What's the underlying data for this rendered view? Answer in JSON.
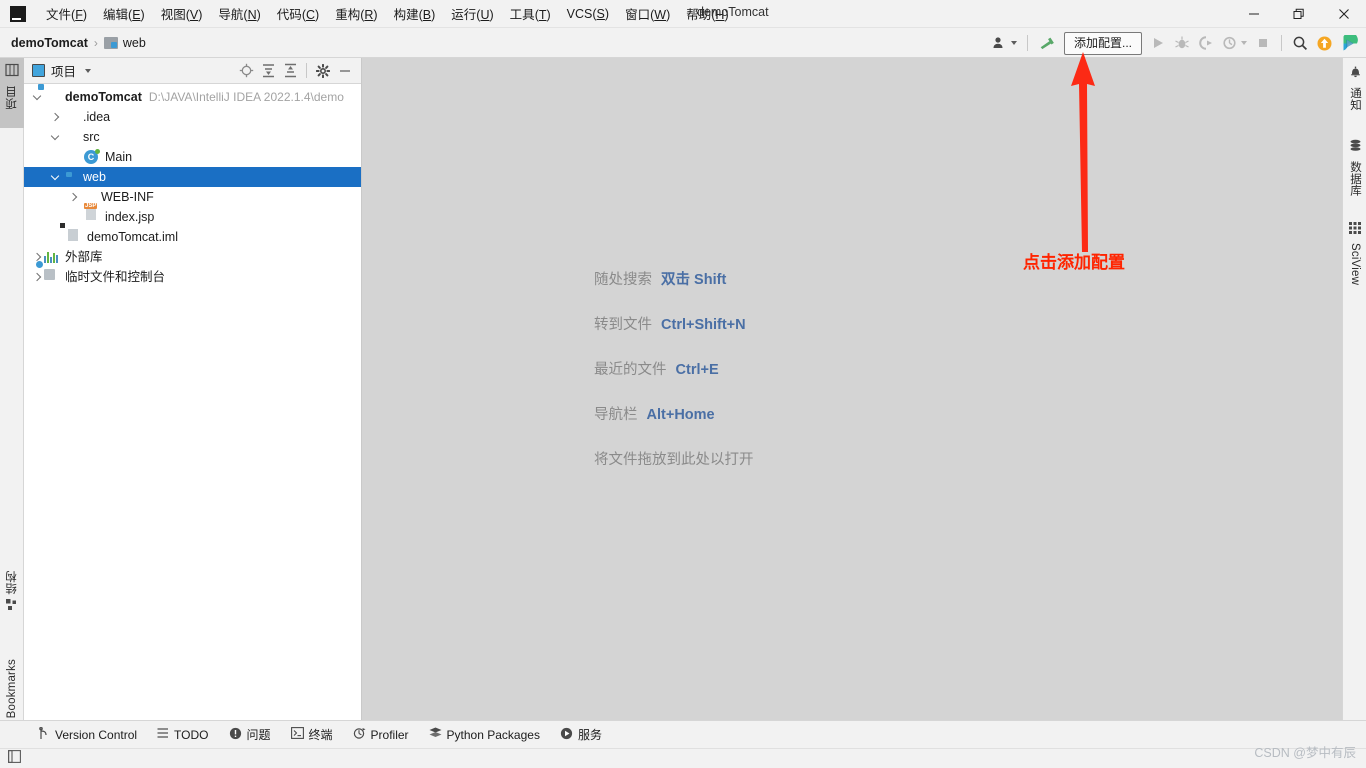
{
  "window": {
    "title": "demoTomcat",
    "controls": {
      "minimize": "—",
      "maximize": "❐",
      "close": "✕"
    }
  },
  "menubar": {
    "logo": "IJ",
    "items": [
      {
        "label": "文件",
        "mnemonic": "F"
      },
      {
        "label": "编辑",
        "mnemonic": "E"
      },
      {
        "label": "视图",
        "mnemonic": "V"
      },
      {
        "label": "导航",
        "mnemonic": "N"
      },
      {
        "label": "代码",
        "mnemonic": "C"
      },
      {
        "label": "重构",
        "mnemonic": "R"
      },
      {
        "label": "构建",
        "mnemonic": "B"
      },
      {
        "label": "运行",
        "mnemonic": "U"
      },
      {
        "label": "工具",
        "mnemonic": "T"
      },
      {
        "label": "VCS",
        "mnemonic": "S"
      },
      {
        "label": "窗口",
        "mnemonic": "W"
      },
      {
        "label": "帮助",
        "mnemonic": "H"
      }
    ]
  },
  "navbar": {
    "breadcrumb": {
      "root": "demoTomcat",
      "separator": "›",
      "leaf": "web"
    },
    "toolbar": {
      "add_config_label": "添加配置...",
      "run_tooltip": "运行",
      "debug_tooltip": "调试",
      "coverage_tooltip": "运行覆盖率",
      "profile_tooltip": "性能分析",
      "stop_tooltip": "停止",
      "search_tooltip": "搜索",
      "update_tooltip": "更新项目",
      "trainer_tooltip": "IDE 功能训练器"
    }
  },
  "left_stripe": {
    "top": [
      {
        "label": "项目",
        "icon": "project-icon",
        "active": true
      }
    ],
    "bottom": [
      {
        "label": "结构",
        "icon": "structure-icon"
      },
      {
        "label": "Bookmarks",
        "icon": "bookmark-icon"
      }
    ]
  },
  "right_stripe": {
    "items": [
      {
        "label": "通知",
        "icon": "bell-icon"
      },
      {
        "label": "数据库",
        "icon": "database-icon"
      },
      {
        "label": "SciView",
        "icon": "grid-icon"
      }
    ]
  },
  "project_panel": {
    "title": "项目",
    "actions": [
      "locate-icon",
      "expand-all-icon",
      "collapse-all-icon",
      "settings-gear-icon",
      "hide-icon"
    ],
    "tree": [
      {
        "label": "demoTomcat",
        "path": "D:\\JAVA\\IntelliJ IDEA 2022.1.4\\demo",
        "icon": "module-icon",
        "depth": 0,
        "state": "expanded",
        "bold": true
      },
      {
        "label": ".idea",
        "icon": "folder-icon",
        "depth": 1,
        "state": "collapsed"
      },
      {
        "label": "src",
        "icon": "source-folder-icon",
        "depth": 1,
        "state": "expanded"
      },
      {
        "label": "Main",
        "icon": "java-class-icon",
        "depth": 2,
        "state": "leaf"
      },
      {
        "label": "web",
        "icon": "web-folder-icon",
        "depth": 1,
        "state": "expanded",
        "selected": true
      },
      {
        "label": "WEB-INF",
        "icon": "folder-icon",
        "depth": 2,
        "state": "collapsed"
      },
      {
        "label": "index.jsp",
        "icon": "jsp-file-icon",
        "depth": 2,
        "state": "leaf"
      },
      {
        "label": "demoTomcat.iml",
        "icon": "iml-file-icon",
        "depth": 1,
        "state": "leaf"
      },
      {
        "label": "外部库",
        "icon": "library-icon",
        "depth": 0,
        "state": "collapsed"
      },
      {
        "label": "临时文件和控制台",
        "icon": "scratches-icon",
        "depth": 0,
        "state": "collapsed"
      }
    ]
  },
  "editor": {
    "hints": [
      {
        "label": "随处搜索",
        "key": "双击 Shift"
      },
      {
        "label": "转到文件",
        "key": "Ctrl+Shift+N"
      },
      {
        "label": "最近的文件",
        "key": "Ctrl+E"
      },
      {
        "label": "导航栏",
        "key": "Alt+Home"
      },
      {
        "label": "将文件拖放到此处以打开",
        "key": ""
      }
    ]
  },
  "annotation": {
    "text": "点击添加配置",
    "color": "#ff2400",
    "arrow": "up-arrow"
  },
  "bottom_bar": {
    "items": [
      {
        "label": "Version Control",
        "icon": "branch-icon"
      },
      {
        "label": "TODO",
        "icon": "list-icon"
      },
      {
        "label": "问题",
        "icon": "warning-icon"
      },
      {
        "label": "终端",
        "icon": "terminal-icon"
      },
      {
        "label": "Profiler",
        "icon": "profiler-icon"
      },
      {
        "label": "Python Packages",
        "icon": "packages-icon"
      },
      {
        "label": "服务",
        "icon": "services-icon"
      }
    ]
  },
  "status_bar": {
    "watermark": "CSDN @梦中有辰"
  },
  "colors": {
    "selection_blue": "#1a6fc4",
    "editor_bg": "#d4d4d4",
    "chrome_bg": "#f2f2f2",
    "hint_key": "#4a6fa5",
    "hint_label": "#8a8a8a",
    "annotation_red": "#ff2400"
  }
}
